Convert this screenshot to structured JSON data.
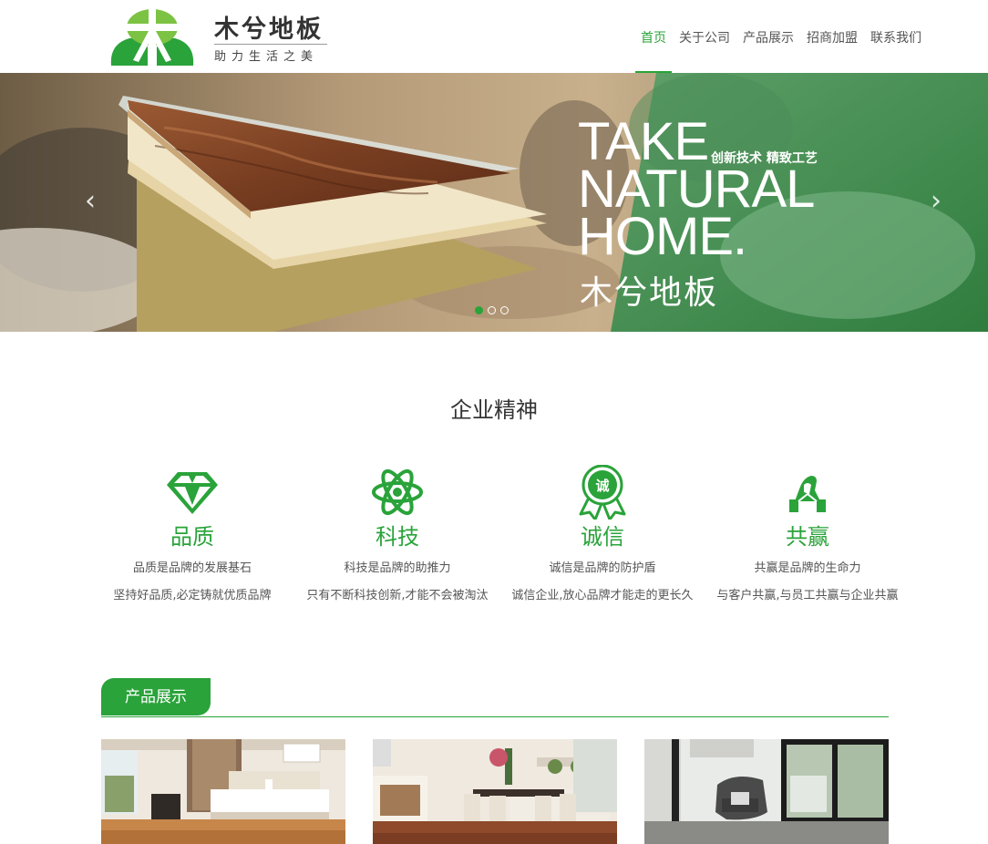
{
  "brand": {
    "name": "木兮地板",
    "slogan": "助力生活之美",
    "green": "#2aa33a"
  },
  "nav": {
    "items": [
      {
        "label": "首页",
        "active": true
      },
      {
        "label": "关于公司"
      },
      {
        "label": "产品展示"
      },
      {
        "label": "招商加盟"
      },
      {
        "label": "联系我们"
      }
    ]
  },
  "banner": {
    "heading_en": "TAKE\nNATURAL\nHOME.",
    "tagline": "创新技术 精致工艺",
    "brand_cn": "木兮地板",
    "prev_icon": "chevron-left-icon",
    "next_icon": "chevron-right-icon",
    "slides": 3,
    "active_slide": 1
  },
  "spirit": {
    "title": "企业精神",
    "items": [
      {
        "icon": "diamond-icon",
        "name": "品质",
        "line1": "品质是品牌的发展基石",
        "line2": "坚持好品质,必定铸就优质品牌"
      },
      {
        "icon": "atom-icon",
        "name": "科技",
        "line1": "科技是品牌的助推力",
        "line2": "只有不断科技创新,才能不会被淘汰"
      },
      {
        "icon": "award-badge-icon",
        "badge_text": "诚",
        "name": "诚信",
        "line1": "诚信是品牌的防护盾",
        "line2": "诚信企业,放心品牌才能走的更长久"
      },
      {
        "icon": "handshake-icon",
        "name": "共赢",
        "line1": "共赢是品牌的生命力",
        "line2": "与客户共赢,与员工共赢与企业共赢"
      }
    ]
  },
  "products": {
    "title": "产品展示"
  }
}
